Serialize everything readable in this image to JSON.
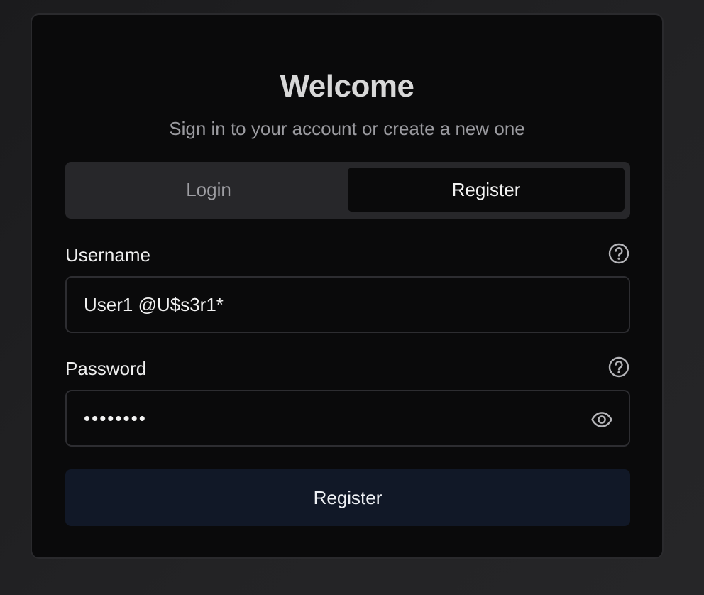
{
  "auth": {
    "title": "Welcome",
    "subtitle": "Sign in to your account or create a new one",
    "tabs": {
      "login": "Login",
      "register": "Register",
      "active": "Register"
    },
    "username": {
      "label": "Username",
      "value": "User1 @U$s3r1*",
      "help_icon": "help-circle-icon"
    },
    "password": {
      "label": "Password",
      "masked_value": "••••••••",
      "help_icon": "help-circle-icon",
      "toggle_icon": "eye-icon"
    },
    "submit_label": "Register"
  },
  "colors": {
    "background": "#1f1f21",
    "card": "#0a0a0b",
    "tab_track": "#27272a",
    "submit_button": "#111827",
    "text_primary": "#f2f2f2",
    "text_muted": "#9b9ba0"
  }
}
